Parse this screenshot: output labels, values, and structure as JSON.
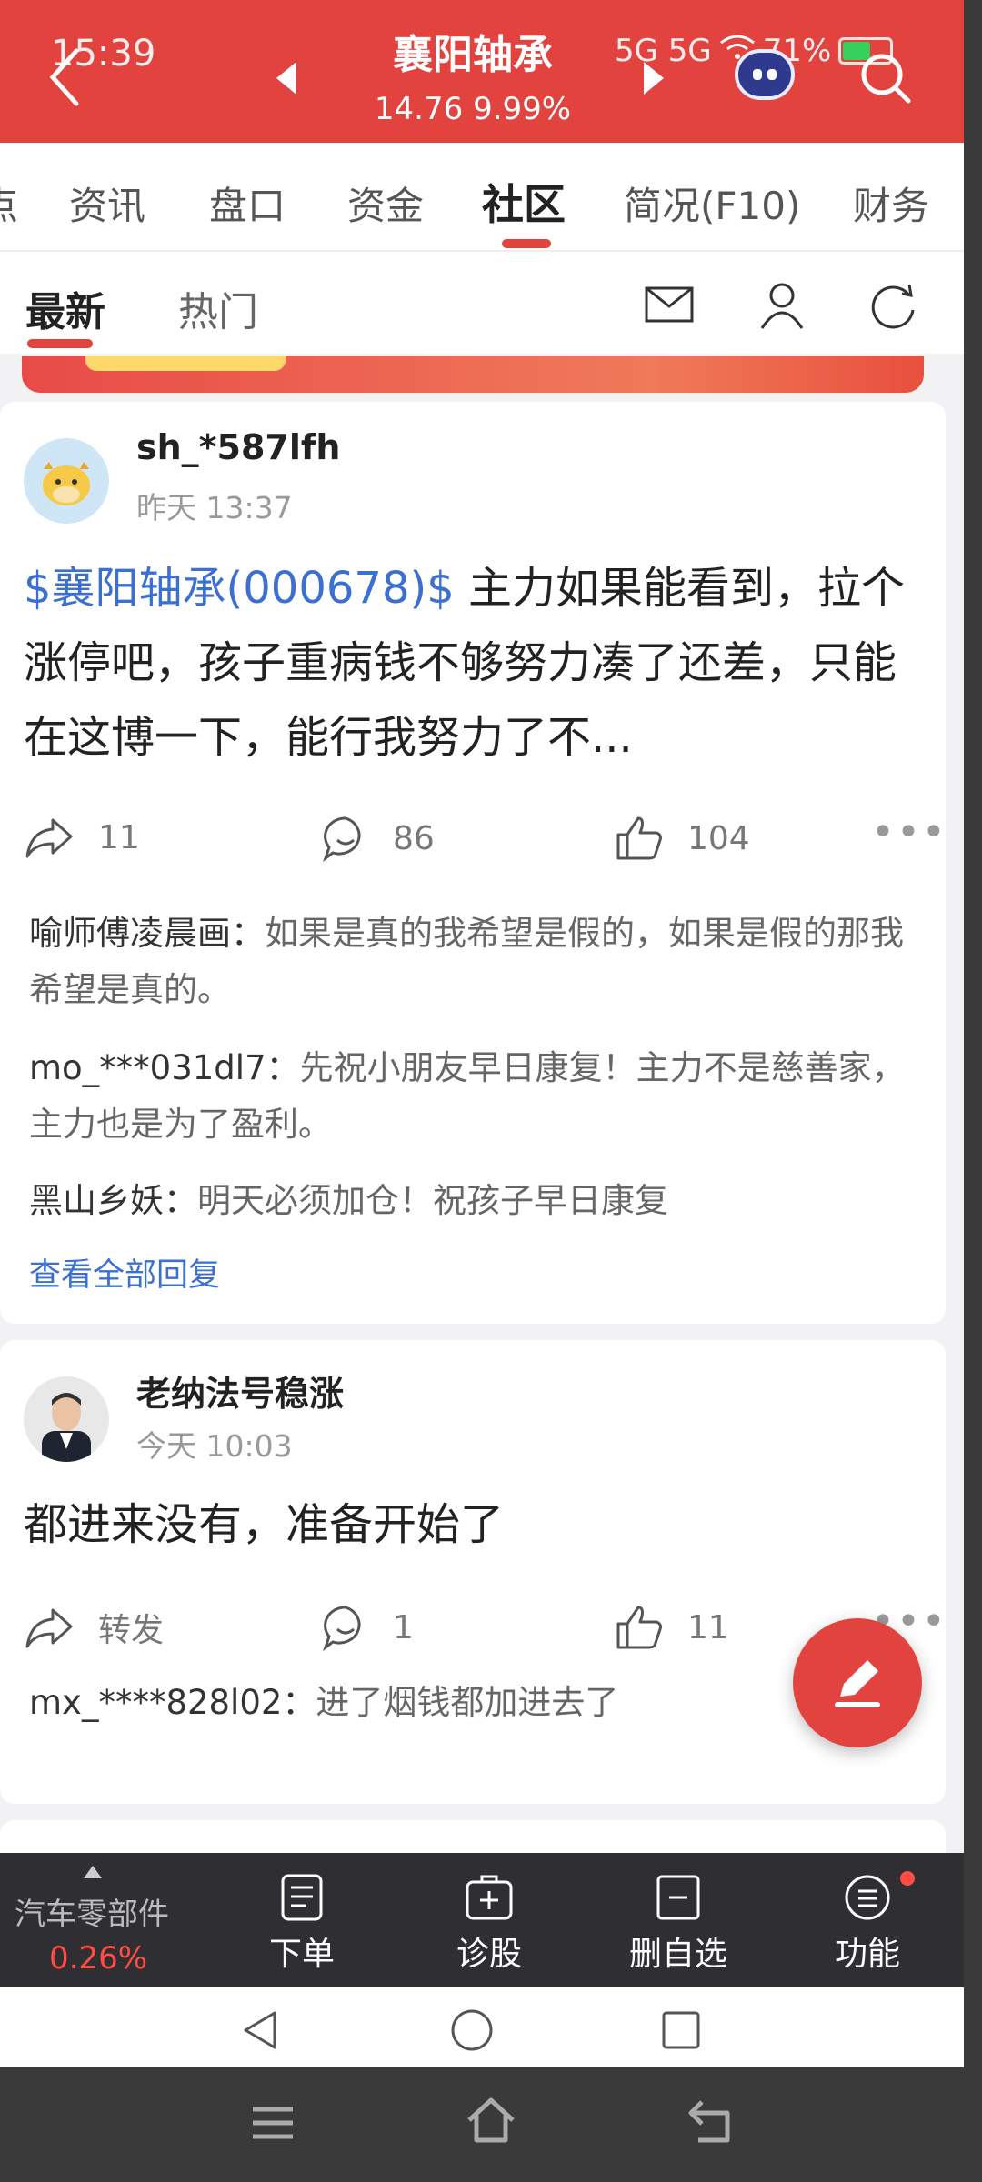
{
  "status": {
    "time": "15:39",
    "signal": "5G 5G",
    "battery": "71%"
  },
  "header": {
    "title": "襄阳轴承",
    "price": "14.76 9.99%"
  },
  "tabs": [
    {
      "label": "点"
    },
    {
      "label": "资讯"
    },
    {
      "label": "盘口"
    },
    {
      "label": "资金"
    },
    {
      "label": "社区"
    },
    {
      "label": "简况(F10)"
    },
    {
      "label": "财务"
    }
  ],
  "subtabs": [
    {
      "label": "最新"
    },
    {
      "label": "热门"
    }
  ],
  "posts": [
    {
      "user": "sh_*587lfh",
      "time": "昨天 13:37",
      "stock_tag": "$襄阳轴承(000678)$",
      "text": " 主力如果能看到，拉个涨停吧，孩子重病钱不够努力凑了还差，只能在这博一下，能行我努力了不...",
      "share": "11",
      "comments": "86",
      "likes": "104",
      "replies": [
        {
          "user": "喻师傅凌晨画：",
          "text": "如果是真的我希望是假的，如果是假的那我希望是真的。"
        },
        {
          "user": "mo_***031dl7：",
          "text": "先祝小朋友早日康复！主力不是慈善家，主力也是为了盈利。"
        },
        {
          "user": "黑山乡妖：",
          "text": "明天必须加仓！祝孩子早日康复"
        }
      ],
      "view_all": "查看全部回复"
    },
    {
      "user": "老纳法号稳涨",
      "time": "今天 10:03",
      "text": "都进来没有，准备开始了",
      "share": "转发",
      "comments": "1",
      "likes": "11",
      "replies": [
        {
          "user": "mx_****828l02：",
          "text": "进了烟钱都加进去了"
        }
      ]
    }
  ],
  "bottom": {
    "sector": "汽车零部件",
    "sector_change": "0.26%",
    "nav": [
      {
        "label": "下单"
      },
      {
        "label": "诊股"
      },
      {
        "label": "删自选"
      },
      {
        "label": "功能"
      }
    ]
  },
  "colors": {
    "brand_red": "#e2433f",
    "link_blue": "#3b6fd1",
    "bottom_bar": "#2f2f33"
  },
  "icons": [
    "back-arrow-icon",
    "robot-icon",
    "search-icon",
    "mail-icon",
    "user-icon",
    "refresh-icon",
    "share-icon",
    "comment-icon",
    "like-icon",
    "more-icon",
    "edit-icon",
    "order-icon",
    "diagnose-icon",
    "remove-watchlist-icon",
    "menu-icon"
  ]
}
